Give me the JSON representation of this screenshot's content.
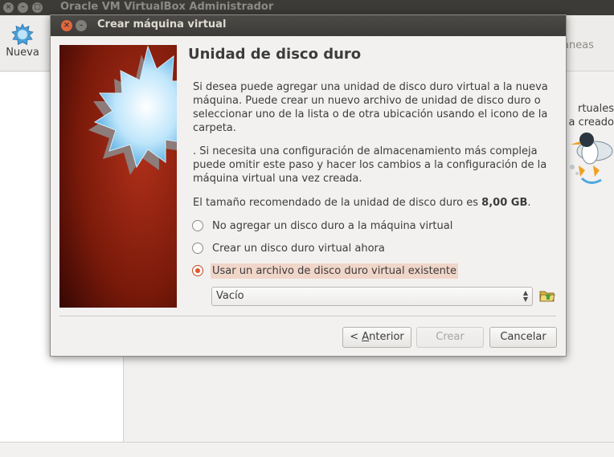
{
  "main_window": {
    "title": "Oracle VM VirtualBox Administrador",
    "toolbar": {
      "new_label": "Nueva",
      "right_partial": "áneas"
    },
    "details_partial": [
      "rtuales",
      "a creado"
    ]
  },
  "dialog": {
    "title": "Crear máquina virtual",
    "page_title": "Unidad de disco duro",
    "paragraph1": "Si desea puede agregar una unidad de disco duro virtual a la nueva máquina. Puede crear un nuevo archivo de unidad de disco duro o seleccionar uno de la lista o de otra ubicación usando el icono de la carpeta.",
    "paragraph2": ". Si necesita una configuración de almacenamiento más compleja puede omitir este paso y hacer los cambios a la configuración de la máquina virtual una vez creada.",
    "recommended_prefix": "El tamaño recomendado de la unidad de disco duro es ",
    "recommended_size": "8,00 GB",
    "recommended_suffix": ".",
    "options": [
      {
        "label": "No agregar un disco duro a la máquina virtual",
        "checked": false
      },
      {
        "label": "Crear un disco duro virtual ahora",
        "checked": false
      },
      {
        "label": "Usar un archivo de disco duro virtual existente",
        "checked": true
      }
    ],
    "combo_value": "Vacío",
    "buttons": {
      "back_prefix": "< ",
      "back_mnemonic": "A",
      "back_rest": "nterior",
      "create": "Crear",
      "cancel": "Cancelar"
    }
  },
  "colors": {
    "accent": "#e0552a",
    "titlebar": "#3c3b37",
    "wizard_bg": "#7a1a0a"
  }
}
